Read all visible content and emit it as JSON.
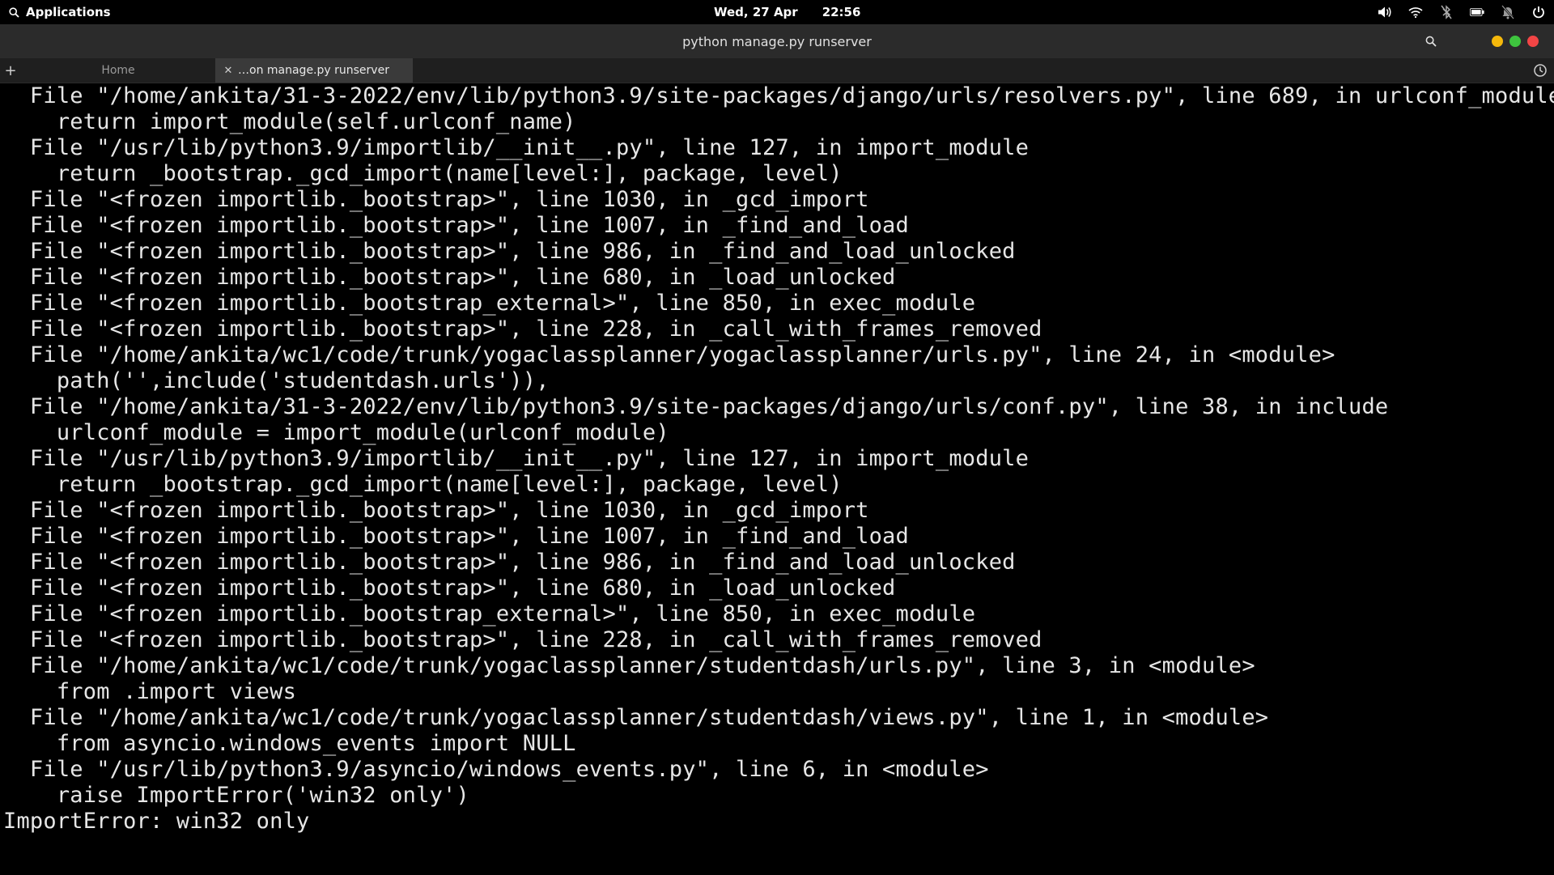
{
  "topbar": {
    "apps_label": "Applications",
    "date": "Wed, 27 Apr",
    "time": "22:56",
    "tray_icons": [
      "volume-icon",
      "wifi-icon",
      "bluetooth-off-icon",
      "battery-icon",
      "notifications-off-icon",
      "power-icon"
    ]
  },
  "window": {
    "title": "python manage.py runserver",
    "controls": {
      "minimize_color": "#f5b80b",
      "maximize_color": "#3ec43e",
      "close_color": "#f24545"
    }
  },
  "tabs": {
    "items": [
      {
        "label": "Home",
        "active": false
      },
      {
        "label": "…on manage.py runserver",
        "active": true
      }
    ]
  },
  "terminal": {
    "lines": [
      "  File \"/home/ankita/31-3-2022/env/lib/python3.9/site-packages/django/urls/resolvers.py\", line 689, in urlconf_module",
      "    return import_module(self.urlconf_name)",
      "  File \"/usr/lib/python3.9/importlib/__init__.py\", line 127, in import_module",
      "    return _bootstrap._gcd_import(name[level:], package, level)",
      "  File \"<frozen importlib._bootstrap>\", line 1030, in _gcd_import",
      "  File \"<frozen importlib._bootstrap>\", line 1007, in _find_and_load",
      "  File \"<frozen importlib._bootstrap>\", line 986, in _find_and_load_unlocked",
      "  File \"<frozen importlib._bootstrap>\", line 680, in _load_unlocked",
      "  File \"<frozen importlib._bootstrap_external>\", line 850, in exec_module",
      "  File \"<frozen importlib._bootstrap>\", line 228, in _call_with_frames_removed",
      "  File \"/home/ankita/wc1/code/trunk/yogaclassplanner/yogaclassplanner/urls.py\", line 24, in <module>",
      "    path('',include('studentdash.urls')),",
      "  File \"/home/ankita/31-3-2022/env/lib/python3.9/site-packages/django/urls/conf.py\", line 38, in include",
      "    urlconf_module = import_module(urlconf_module)",
      "  File \"/usr/lib/python3.9/importlib/__init__.py\", line 127, in import_module",
      "    return _bootstrap._gcd_import(name[level:], package, level)",
      "  File \"<frozen importlib._bootstrap>\", line 1030, in _gcd_import",
      "  File \"<frozen importlib._bootstrap>\", line 1007, in _find_and_load",
      "  File \"<frozen importlib._bootstrap>\", line 986, in _find_and_load_unlocked",
      "  File \"<frozen importlib._bootstrap>\", line 680, in _load_unlocked",
      "  File \"<frozen importlib._bootstrap_external>\", line 850, in exec_module",
      "  File \"<frozen importlib._bootstrap>\", line 228, in _call_with_frames_removed",
      "  File \"/home/ankita/wc1/code/trunk/yogaclassplanner/studentdash/urls.py\", line 3, in <module>",
      "    from .import views",
      "  File \"/home/ankita/wc1/code/trunk/yogaclassplanner/studentdash/views.py\", line 1, in <module>",
      "    from asyncio.windows_events import NULL",
      "  File \"/usr/lib/python3.9/asyncio/windows_events.py\", line 6, in <module>",
      "    raise ImportError('win32 only')",
      "ImportError: win32 only"
    ]
  }
}
